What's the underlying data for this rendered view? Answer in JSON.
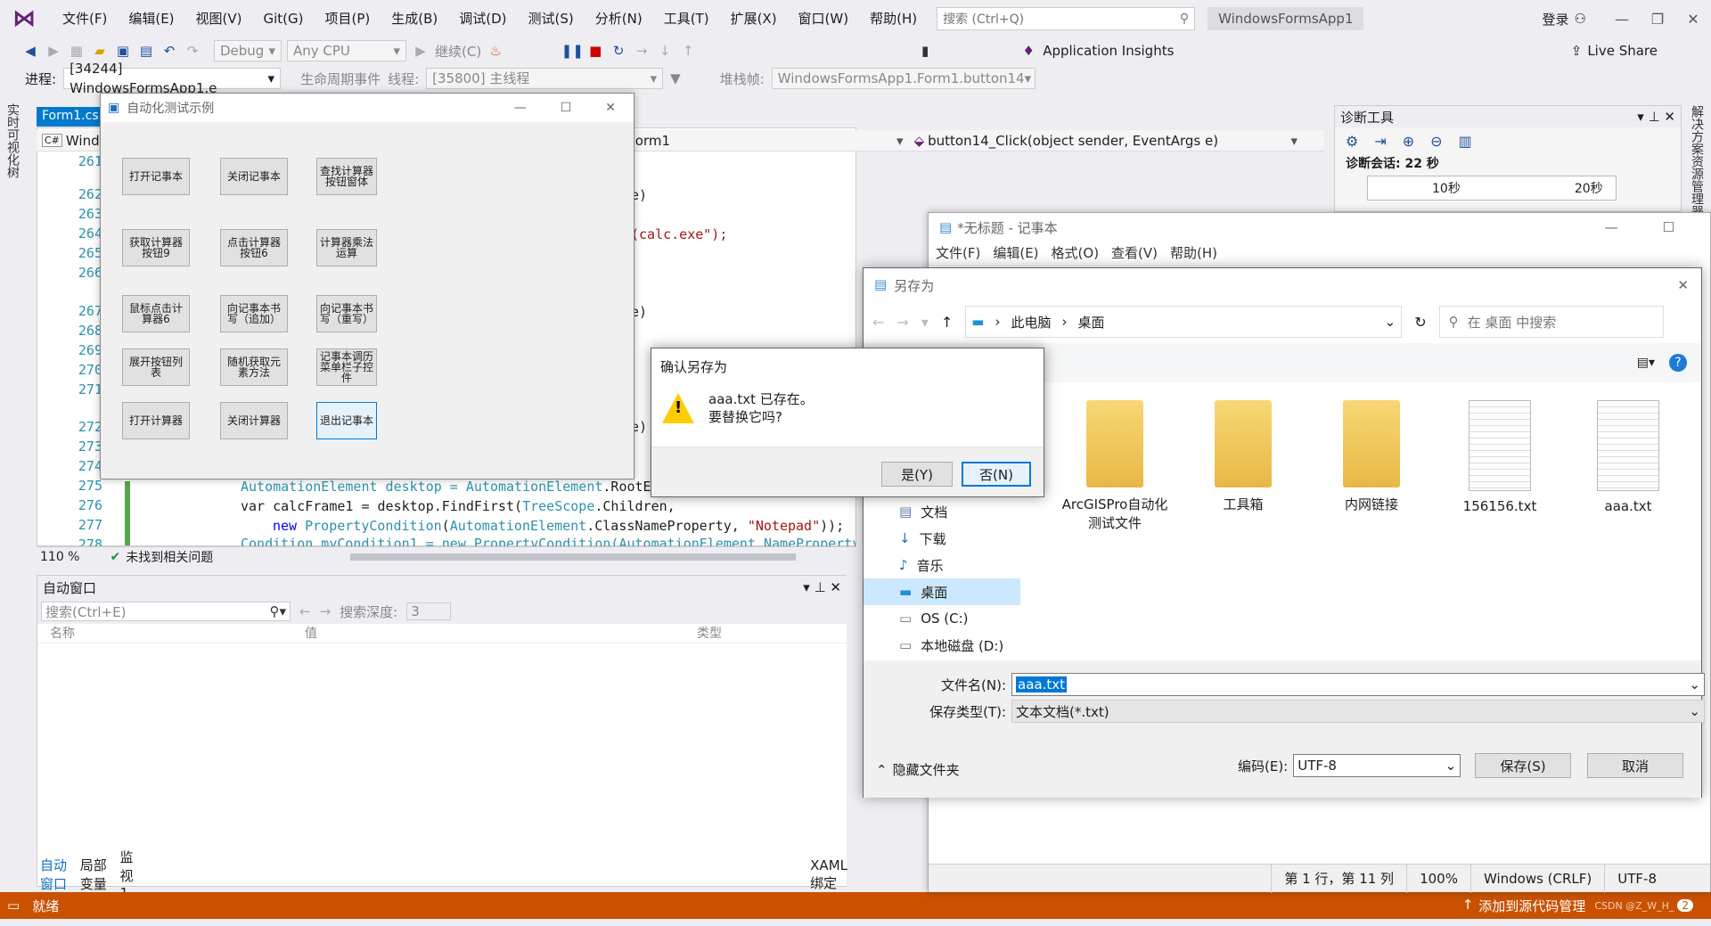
{
  "menubar": {
    "items": [
      "文件(F)",
      "编辑(E)",
      "视图(V)",
      "Git(G)",
      "项目(P)",
      "生成(B)",
      "调试(D)",
      "测试(S)",
      "分析(N)",
      "工具(T)",
      "扩展(X)",
      "窗口(W)",
      "帮助(H)"
    ],
    "search_placeholder": "搜索 (Ctrl+Q)",
    "app_name": "WindowsFormsApp1",
    "login": "登录"
  },
  "toolbar": {
    "config": "Debug",
    "platform": "Any CPU",
    "continue": "继续(C)",
    "insights": "Application Insights",
    "live_share": "Live Share"
  },
  "debugbar": {
    "process_label": "进程:",
    "process": "[34244] WindowsFormsApp1.e",
    "lifecycle": "生命周期事件",
    "thread_label": "线程:",
    "thread": "[35800] 主线程",
    "stack_label": "堆栈帧:",
    "stack": "WindowsFormsApp1.Form1.button14"
  },
  "left_strip": {
    "label": "实时可视化树"
  },
  "right_strip": {
    "label": "解决方案资源管理器"
  },
  "editor": {
    "tab": "Form1.cs",
    "nav_left": "Windo",
    "nav_mid": "orm1",
    "nav_right": "button14_Click(object sender, EventArgs e)",
    "lines": [
      "261",
      "262",
      "263",
      "264",
      "265",
      "266",
      "267",
      "268",
      "269",
      "270",
      "271",
      "272",
      "273",
      "274",
      "275",
      "276",
      "277",
      "278"
    ],
    "frag_262": "e)",
    "frag_264": "(calc.exe\");",
    "frag_267": "e)",
    "frag_272": "e)",
    "code_275a": "AutomationElement desktop = ",
    "code_275b": "AutomationElement",
    "code_275c": ".RootEl",
    "code_276a": "var calcFrame1 = desktop.FindFirst(",
    "code_276b": "TreeScope",
    "code_276c": ".Children,",
    "code_277a": "new ",
    "code_277b": "PropertyCondition",
    "code_277c": "(",
    "code_277d": "AutomationElement",
    "code_277e": ".ClassNameProperty, ",
    "code_277f": "\"Notepad\"",
    "code_277g": "));",
    "code_278": "Condition myCondition1 = new PropertyCondition(AutomationElement.NameProperty,",
    "zoom": "110 %",
    "issues": "未找到相关问题"
  },
  "autos": {
    "title": "自动窗口",
    "search_placeholder": "搜索(Ctrl+E)",
    "depth_label": "搜索深度:",
    "depth": "3",
    "col_name": "名称",
    "col_value": "值",
    "col_type": "类型",
    "tabs": [
      "自动窗口",
      "局部变量",
      "监视 1"
    ],
    "xaml": "XAML 绑定"
  },
  "diag": {
    "title": "诊断工具",
    "session": "诊断会话: 22 秒",
    "t1": "10秒",
    "t2": "20秒"
  },
  "status": {
    "ready": "就绪",
    "source": "添加到源代码管理",
    "badge": "2",
    "watermark": "CSDN @Z_W_H_"
  },
  "form": {
    "title": "自动化测试示例",
    "buttons": [
      "打开记事本",
      "关闭记事本",
      "查找计算器按钮窗体",
      "获取计算器按钮9",
      "点击计算器按钮6",
      "计算器乘法运算",
      "鼠标点击计算器6",
      "向记事本书写（追加）",
      "向记事本书写（重写）",
      "展开按钮列表",
      "随机获取元素方法",
      "记事本调历菜单栏子控件",
      "打开计算器",
      "关闭计算器",
      "退出记事本"
    ]
  },
  "notepad": {
    "title": "*无标题 - 记事本",
    "menu": [
      "文件(F)",
      "编辑(E)",
      "格式(O)",
      "查看(V)",
      "帮助(H)"
    ],
    "pos": "第 1 行，第 11 列",
    "zoom": "100%",
    "eol": "Windows (CRLF)",
    "enc": "UTF-8"
  },
  "save": {
    "title": "另存为",
    "path1": "此电脑",
    "path2": "桌面",
    "search_placeholder": "在 桌面 中搜索",
    "tree": [
      "文档",
      "下载",
      "音乐",
      "桌面",
      "OS (C:)",
      "本地磁盘 (D:)"
    ],
    "files": [
      "ArcGISPro自动化测试文件",
      "工具箱",
      "内网链接",
      "156156.txt",
      "aaa.txt"
    ],
    "filename_label": "文件名(N):",
    "filename": "aaa.txt",
    "type_label": "保存类型(T):",
    "type": "文本文档(*.txt)",
    "hide_folders": "隐藏文件夹",
    "encoding_label": "编码(E):",
    "encoding": "UTF-8",
    "save_btn": "保存(S)",
    "cancel_btn": "取消"
  },
  "confirm": {
    "title": "确认另存为",
    "line1": "aaa.txt 已存在。",
    "line2": "要替换它吗?",
    "yes": "是(Y)",
    "no": "否(N)"
  }
}
